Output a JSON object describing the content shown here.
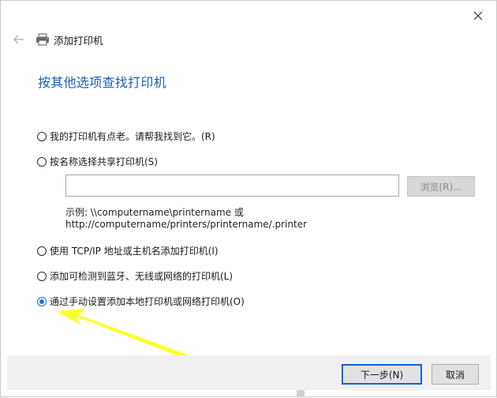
{
  "window": {
    "title": "添加打印机"
  },
  "page": {
    "heading": "按其他选项查找打印机"
  },
  "options": [
    {
      "label": "我的打印机有点老。请帮我找到它。(R)",
      "checked": false
    },
    {
      "label": "按名称选择共享打印机(S)",
      "checked": false
    },
    {
      "label": "使用 TCP/IP 地址或主机名添加打印机(I)",
      "checked": false
    },
    {
      "label": "添加可检测到蓝牙、无线或网络的打印机(L)",
      "checked": false
    },
    {
      "label": "通过手动设置添加本地打印机或网络打印机(O)",
      "checked": true
    }
  ],
  "shared": {
    "input_value": "",
    "browse_label": "浏览(R)...",
    "hint_line1": "示例: \\\\computername\\printername 或",
    "hint_line2": "http://computername/printers/printername/.printer"
  },
  "buttons": {
    "next": "下一步(N)",
    "cancel": "取消"
  },
  "icons": {
    "close": "close-icon",
    "back": "back-arrow-icon",
    "printer": "printer-icon"
  },
  "colors": {
    "heading": "#1a5fb4",
    "annotation_arrow": "#ffff33",
    "primary_border": "#0a64d6"
  }
}
